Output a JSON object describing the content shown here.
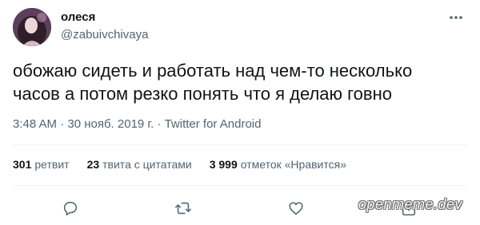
{
  "author": {
    "name": "олеся",
    "handle": "@zabuivchivaya"
  },
  "tweet": {
    "text": "обожаю сидеть и работать над чем-то несколько\nчасов а потом резко понять что я делаю говно",
    "time": "3:48 AM · 30 нояб. 2019 г. · ",
    "source": "Twitter for Android"
  },
  "stats": {
    "retweets_count": "301",
    "retweets_label": "ретвит",
    "quotes_count": "23",
    "quotes_label": "твита с цитатами",
    "likes_count": "3 999",
    "likes_label": "отметок «Нравится»"
  },
  "watermark": "openmeme.dev",
  "colors": {
    "text": "#0f1419",
    "secondary": "#536471",
    "divider": "#eff3f4"
  },
  "icons": {
    "more": "more-dots-icon",
    "reply": "reply-icon",
    "retweet": "retweet-icon",
    "like": "heart-icon",
    "share": "share-icon"
  }
}
